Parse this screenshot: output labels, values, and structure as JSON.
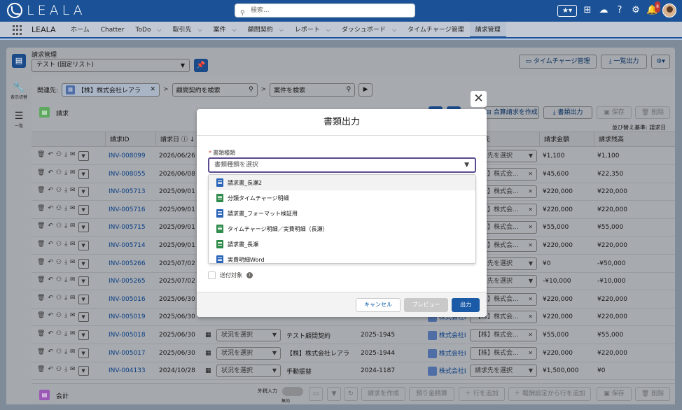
{
  "topbar": {
    "logo": "LEALA",
    "search_placeholder": "検索...",
    "notification_count": "8"
  },
  "nav": {
    "app_name": "LEALA",
    "items": [
      {
        "label": "ホーム",
        "has_menu": false
      },
      {
        "label": "Chatter",
        "has_menu": false
      },
      {
        "label": "ToDo",
        "has_menu": true
      },
      {
        "label": "取引先",
        "has_menu": true
      },
      {
        "label": "案件",
        "has_menu": true
      },
      {
        "label": "顧問契約",
        "has_menu": true
      },
      {
        "label": "レポート",
        "has_menu": true
      },
      {
        "label": "ダッシュボード",
        "has_menu": true
      },
      {
        "label": "タイムチャージ管理",
        "has_menu": false
      },
      {
        "label": "請求管理",
        "has_menu": false
      }
    ]
  },
  "header": {
    "title": "請求管理",
    "list_view": "テスト (固定リスト)",
    "btn_timecharge": "タイムチャージ管理",
    "btn_export": "一覧出力"
  },
  "sidebar": {
    "toggle_label": "表示切替",
    "list_label": "一覧"
  },
  "relations": {
    "label": "関連先:",
    "account_value": "【株】株式会社レアラ",
    "contract_placeholder": "顧問契約を検索",
    "case_placeholder": "案件を検索"
  },
  "section": {
    "title": "請求",
    "btn_combine": "合算請求を作成",
    "btn_docs": "書類出力",
    "btn_save": "保存",
    "btn_delete": "削除",
    "sort_label": "並び替え基準: 請求日"
  },
  "table": {
    "headers": {
      "id": "請求ID",
      "date": "請求日",
      "billto": "請求先",
      "amount": "請求金額",
      "balance": "請求残高"
    },
    "billto_placeholder": "請求先を選択",
    "status_placeholder": "状況を選択",
    "rows": [
      {
        "id": "INV-008099",
        "date": "2026/06/26",
        "account": "",
        "billto": "請求先を選択",
        "amount": "¥1,100",
        "balance": "¥1,100"
      },
      {
        "id": "INV-008055",
        "date": "2026/06/08",
        "account": "株式会社L",
        "billto": "【株】株式会...",
        "amount": "¥45,600",
        "balance": "¥22,350"
      },
      {
        "id": "INV-005713",
        "date": "2025/09/01",
        "account": "株式会社L",
        "billto": "【株】株式会...",
        "amount": "¥220,000",
        "balance": "¥220,000"
      },
      {
        "id": "INV-005716",
        "date": "2025/09/01",
        "account": "株式会社L",
        "billto": "【株】株式会...",
        "amount": "¥220,000",
        "balance": "¥220,000"
      },
      {
        "id": "INV-005715",
        "date": "2025/09/01",
        "account": "株式会社L",
        "billto": "【株】株式会...",
        "amount": "¥55,000",
        "balance": "¥55,000"
      },
      {
        "id": "INV-005714",
        "date": "2025/09/01",
        "account": "株式会社L",
        "billto": "【株】株式会...",
        "amount": "¥220,000",
        "balance": "¥220,000"
      },
      {
        "id": "INV-005266",
        "date": "2025/07/02",
        "account": "株式会社LA",
        "billto": "請求先を選択",
        "amount": "¥0",
        "balance": "-¥50,000"
      },
      {
        "id": "INV-005265",
        "date": "2025/07/02",
        "account": "株式会社LA",
        "billto": "請求先を選択",
        "amount": "-¥10,000",
        "balance": "-¥10,000"
      },
      {
        "id": "INV-005016",
        "date": "2025/06/30",
        "account": "株式会社L",
        "billto": "【株】株式会...",
        "amount": "¥220,000",
        "balance": "¥220,000"
      },
      {
        "id": "INV-005019",
        "date": "2025/06/30",
        "account": "株式会社L",
        "billto": "【株】株式会...",
        "amount": "¥220,000",
        "balance": "¥220,000"
      },
      {
        "id": "INV-005018",
        "date": "2025/06/30",
        "subject": "テスト顧問契約",
        "contract": "2025-1945",
        "account": "株式会社L",
        "billto": "【株】株式会...",
        "amount": "¥55,000",
        "balance": "¥55,000"
      },
      {
        "id": "INV-005017",
        "date": "2025/06/30",
        "subject": "【株】株式会社レアラ",
        "contract": "2025-1944",
        "account": "株式会社L",
        "billto": "【株】株式会...",
        "amount": "¥220,000",
        "balance": "¥220,000"
      },
      {
        "id": "INV-004133",
        "date": "2024/10/28",
        "subject": "手動振替",
        "contract": "2024-1187",
        "account": "株式会社L",
        "billto": "請求先を選択",
        "amount": "¥1,500,000",
        "balance": "¥0"
      }
    ]
  },
  "footer": {
    "title": "会計",
    "tax_label": "外税入力",
    "tax_state": "無効",
    "btn_create": "請求を作成",
    "btn_deposit": "預り金精算",
    "btn_addrow": "行を追加",
    "btn_addfromreward": "報酬設定から行を追加",
    "btn_save": "保存",
    "btn_delete": "削除"
  },
  "modal": {
    "title": "書類出力",
    "field_label": "書類種類",
    "placeholder": "書類種類を選択",
    "options": [
      {
        "label": "請求書_長瀬2",
        "icon": "word"
      },
      {
        "label": "分類タイムチャージ明細",
        "icon": "excel"
      },
      {
        "label": "請求書_フォーマット検証用",
        "icon": "word"
      },
      {
        "label": "タイムチャージ明細／実費明細（長瀬）",
        "icon": "excel"
      },
      {
        "label": "請求書_長瀬",
        "icon": "excel"
      },
      {
        "label": "実費明細Word",
        "icon": "word"
      }
    ],
    "checkbox_label": "送付対象",
    "btn_cancel": "キャンセル",
    "btn_preview": "プレビュー",
    "btn_output": "出力"
  }
}
